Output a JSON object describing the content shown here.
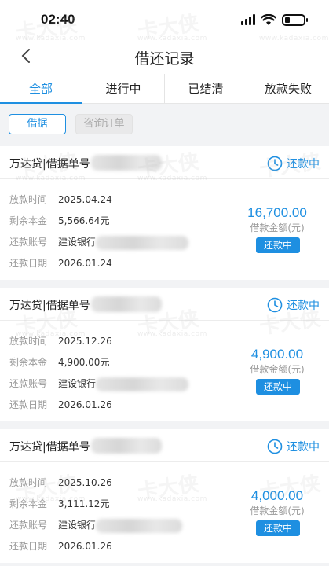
{
  "status_bar": {
    "time": "02:40"
  },
  "nav": {
    "title": "借还记录"
  },
  "tabs": [
    {
      "label": "全部",
      "active": true
    },
    {
      "label": "进行中",
      "active": false
    },
    {
      "label": "已结清",
      "active": false
    },
    {
      "label": "放款失败",
      "active": false
    }
  ],
  "filters": {
    "borrow": "借据",
    "consult": "咨询订单"
  },
  "labels": {
    "loan_time": "放款时间",
    "remaining": "剩余本金",
    "account": "还款账号",
    "due_date": "还款日期",
    "amount_label": "借款金额(元)",
    "bank": "建设银行"
  },
  "cards": [
    {
      "title": "万达贷|借据单号",
      "status": "还款中",
      "loan_time": "2025.04.24",
      "remaining": "5,566.64元",
      "due_date": "2026.01.24",
      "amount": "16,700.00",
      "button": "还款中"
    },
    {
      "title": "万达贷|借据单号",
      "status": "还款中",
      "loan_time": "2025.12.26",
      "remaining": "4,900.00元",
      "due_date": "2026.01.26",
      "amount": "4,900.00",
      "button": "还款中"
    },
    {
      "title": "万达贷|借据单号",
      "status": "还款中",
      "loan_time": "2025.10.26",
      "remaining": "3,111.12元",
      "due_date": "2026.01.26",
      "amount": "4,000.00",
      "button": "还款中"
    }
  ],
  "colors": {
    "accent": "#1e8fe1",
    "background": "#f2f3f5"
  },
  "icons": {
    "back": "chevron-left-icon",
    "status": "clock-icon",
    "signal": "signal-icon",
    "wifi": "wifi-icon",
    "battery": "battery-icon"
  },
  "watermark": {
    "text": "卡大侠",
    "url": "www.kadaxia.com"
  }
}
